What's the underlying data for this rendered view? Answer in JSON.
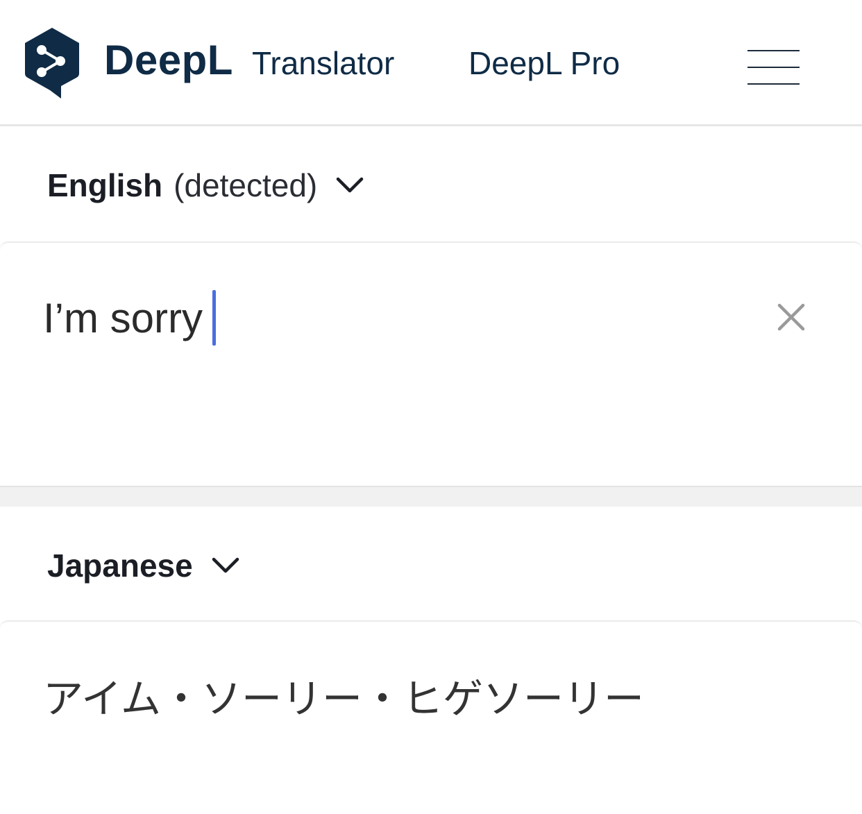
{
  "header": {
    "brand": "DeepL",
    "product": "Translator",
    "pro_link": "DeepL Pro"
  },
  "source": {
    "language": "English",
    "detected_label": "(detected)",
    "text": "I’m sorry"
  },
  "target": {
    "language": "Japanese",
    "text": "アイム・ソーリー・ヒゲソーリー"
  },
  "colors": {
    "brand_navy": "#0f2b46",
    "caret_blue": "#4a6ee0",
    "separator_gray": "#f1f1f1"
  },
  "icons": {
    "logo": "deepl-logo-icon",
    "menu": "hamburger-menu-icon",
    "dropdown": "chevron-down-icon",
    "clear": "close-icon"
  }
}
